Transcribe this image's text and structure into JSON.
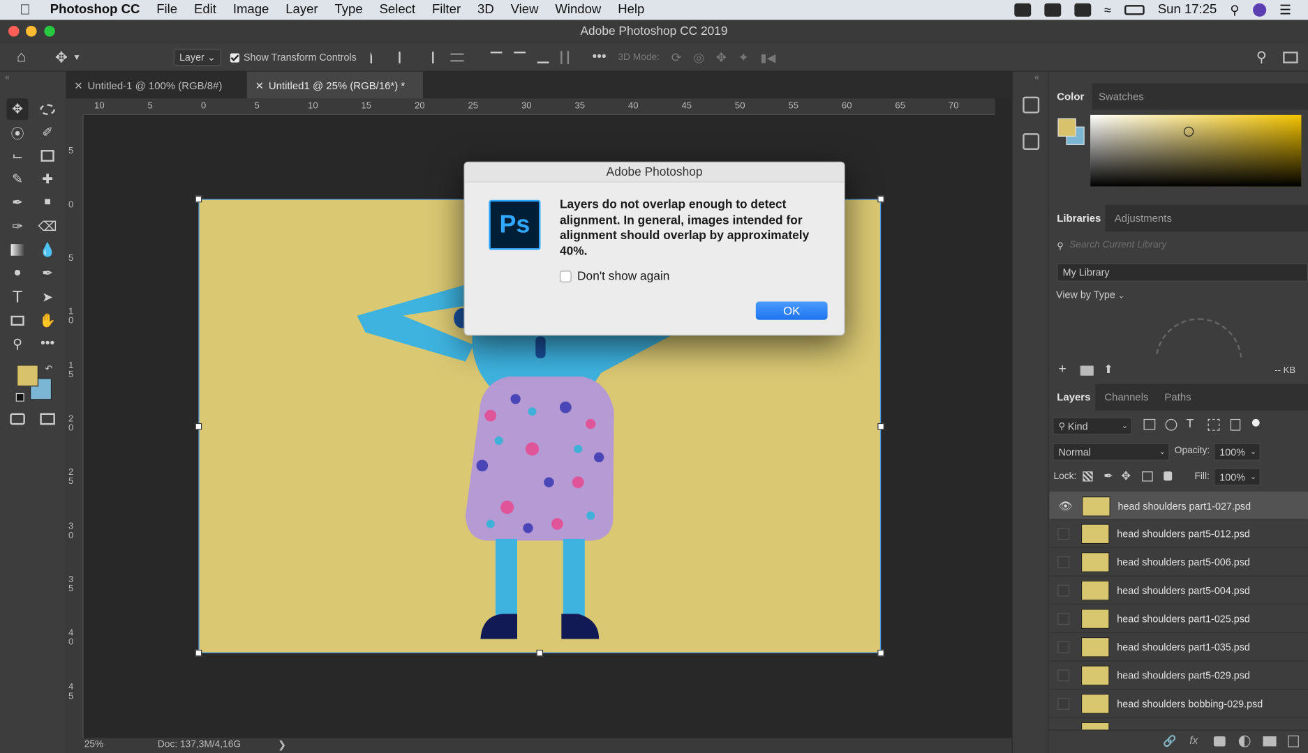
{
  "menubar": {
    "app_name": "Photoshop CC",
    "items": [
      "File",
      "Edit",
      "Image",
      "Layer",
      "Type",
      "Select",
      "Filter",
      "3D",
      "View",
      "Window",
      "Help"
    ],
    "clock": "Sun 17:25"
  },
  "window": {
    "title": "Adobe Photoshop CC 2019"
  },
  "options": {
    "auto_select": "Layer",
    "show_transform_controls": "Show Transform Controls",
    "three_d_mode": "3D Mode:"
  },
  "tabs": [
    {
      "label": "Untitled-1 @ 100% (RGB/8#)"
    },
    {
      "label": "Untitled1 @ 25% (RGB/16*) *"
    }
  ],
  "rulers": {
    "h_ticks": [
      "10",
      "5",
      "0",
      "5",
      "10",
      "15",
      "20",
      "25",
      "30",
      "35",
      "40",
      "45",
      "50",
      "55",
      "60",
      "65",
      "70"
    ],
    "v_ticks": [
      "5",
      "0",
      "5",
      "1\n0",
      "1\n5",
      "2\n0",
      "2\n5",
      "3\n0",
      "3\n5",
      "4\n0",
      "4\n5"
    ]
  },
  "status": {
    "zoom": "25%",
    "doc": "Doc: 137,3M/4,16G"
  },
  "dialog": {
    "title": "Adobe Photoshop",
    "logo": "Ps",
    "message": "Layers do not overlap enough to detect alignment. In general, images intended for alignment should overlap by approximately 40%.",
    "checkbox_label": "Don't show again",
    "ok_label": "OK"
  },
  "color_panel": {
    "tabs": [
      "Color",
      "Swatches"
    ],
    "foreground": "#d8c26c",
    "background": "#7bb6d4"
  },
  "libraries_panel": {
    "tabs": [
      "Libraries",
      "Adjustments"
    ],
    "search_placeholder": "Search Current Library",
    "library": "My Library",
    "view_by": "View by Type",
    "size": "-- KB"
  },
  "layers_panel": {
    "tabs": [
      "Layers",
      "Channels",
      "Paths"
    ],
    "filter": "Kind",
    "blend_mode": "Normal",
    "opacity_label": "Opacity:",
    "opacity": "100%",
    "lock_label": "Lock:",
    "fill_label": "Fill:",
    "fill": "100%",
    "layers": [
      "head shoulders part1-027.psd",
      "head shoulders part5-012.psd",
      "head shoulders part5-006.psd",
      "head shoulders part5-004.psd",
      "head shoulders part1-025.psd",
      "head shoulders part1-035.psd",
      "head shoulders part5-029.psd",
      "head shoulders bobbing-029.psd"
    ]
  }
}
